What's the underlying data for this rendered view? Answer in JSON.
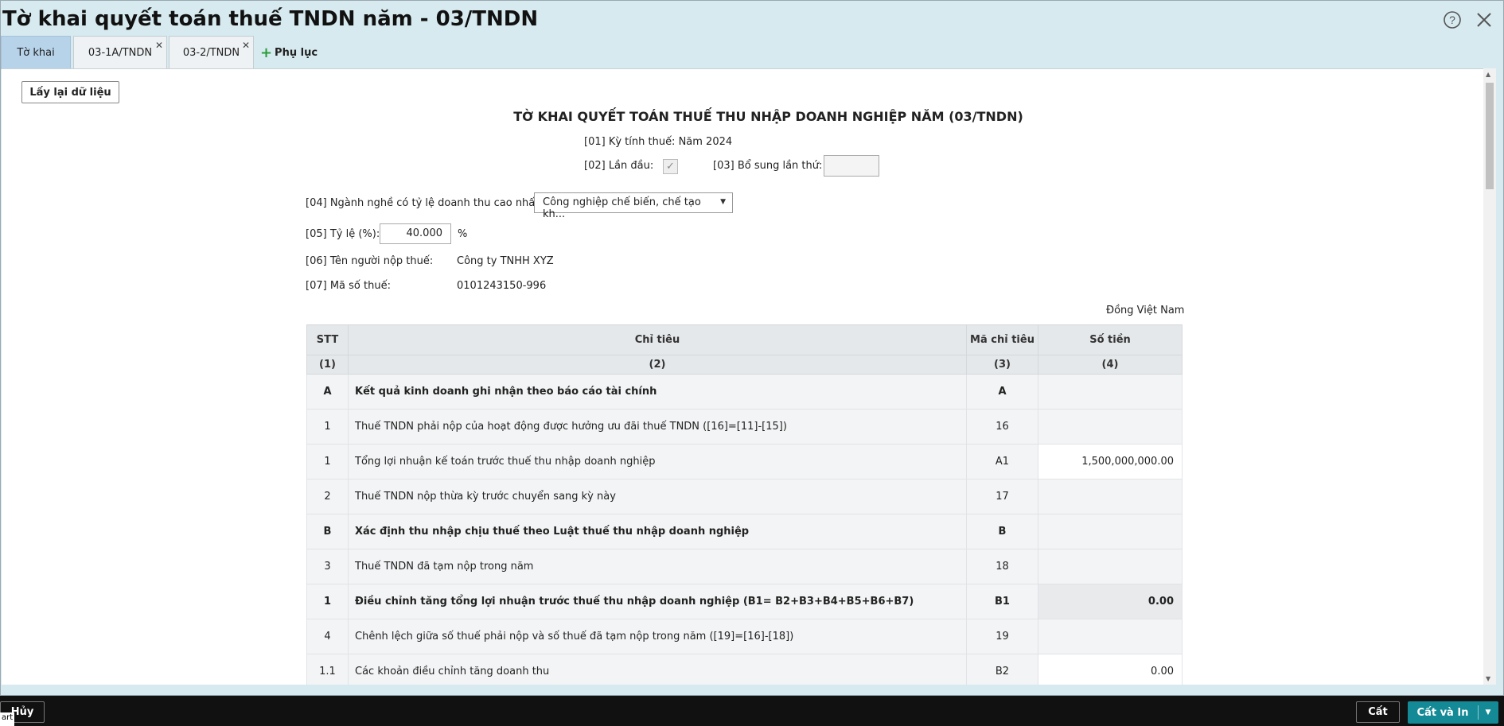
{
  "window": {
    "title": "Tờ khai quyết toán thuế TNDN năm - 03/TNDN",
    "help_icon": "help-circle-icon",
    "close_icon": "close-icon"
  },
  "tabs": [
    {
      "label": "Tờ khai",
      "active": true,
      "closable": false
    },
    {
      "label": "03-1A/TNDN",
      "active": false,
      "closable": true
    },
    {
      "label": "03-2/TNDN",
      "active": false,
      "closable": true
    }
  ],
  "add_tab_label": "Phụ lục",
  "reload_button": "Lấy lại dữ liệu",
  "form": {
    "title": "TỜ KHAI QUYẾT TOÁN THUẾ THU NHẬP DOANH NGHIỆP NĂM (03/TNDN)",
    "period": "[01] Kỳ tính thuế: Năm 2024",
    "first_time_label": "[02] Lần đầu:",
    "first_time_checked": true,
    "supplement_label": "[03] Bổ sung lần thứ:",
    "supplement_value": "",
    "industry_label": "[04] Ngành nghề có tỷ lệ doanh thu cao nhất:",
    "industry_value": "Công nghiệp chế biến, chế tạo kh...",
    "rate_label": "[05] Tỷ lệ (%):",
    "rate_value": "40.000",
    "rate_unit": "%",
    "taxpayer_label": "[06] Tên người nộp thuế:",
    "taxpayer_value": "Công ty TNHH XYZ",
    "tax_code_label": "[07] Mã số thuế:",
    "tax_code_value": "0101243150-996",
    "currency_note": "Đồng Việt Nam"
  },
  "table": {
    "headers": [
      "STT",
      "Chỉ tiêu",
      "Mã chỉ tiêu",
      "Số tiền"
    ],
    "subheaders": [
      "(1)",
      "(2)",
      "(3)",
      "(4)"
    ],
    "rows": [
      {
        "stt": "A",
        "name": "Kết quả kinh doanh ghi nhận theo báo cáo tài chính",
        "code": "A",
        "amount": "",
        "bold": true,
        "amount_style": "none"
      },
      {
        "stt": "1",
        "name": "Thuế TNDN phải nộp của hoạt động được hưởng ưu đãi thuế TNDN ([16]=[11]-[15])",
        "code": "16",
        "amount": "",
        "bold": false,
        "amount_style": "none"
      },
      {
        "stt": "1",
        "name": "Tổng lợi nhuận kế toán trước thuế thu nhập doanh nghiệp",
        "code": "A1",
        "amount": "1,500,000,000.00",
        "bold": false,
        "amount_style": "editable"
      },
      {
        "stt": "2",
        "name": "Thuế TNDN nộp thừa kỳ trước chuyển sang kỳ này",
        "code": "17",
        "amount": "",
        "bold": false,
        "amount_style": "none"
      },
      {
        "stt": "B",
        "name": "Xác định thu nhập chịu thuế theo Luật thuế thu nhập doanh nghiệp",
        "code": "B",
        "amount": "",
        "bold": true,
        "amount_style": "none"
      },
      {
        "stt": "3",
        "name": "Thuế TNDN đã tạm nộp trong năm",
        "code": "18",
        "amount": "",
        "bold": false,
        "amount_style": "none"
      },
      {
        "stt": "1",
        "name": "Điều chỉnh tăng tổng lợi nhuận trước thuế thu nhập doanh nghiệp (B1= B2+B3+B4+B5+B6+B7)",
        "code": "B1",
        "amount": "0.00",
        "bold": true,
        "amount_style": "computed"
      },
      {
        "stt": "4",
        "name": "Chênh lệch giữa số thuế phải nộp và số thuế đã tạm nộp trong năm ([19]=[16]-[18])",
        "code": "19",
        "amount": "",
        "bold": false,
        "amount_style": "none"
      },
      {
        "stt": "1.1",
        "name": "Các khoản điều chỉnh tăng doanh thu",
        "code": "B2",
        "amount": "0.00",
        "bold": false,
        "amount_style": "editable"
      }
    ]
  },
  "footer": {
    "cancel": "Hủy",
    "start_tag": "art",
    "save": "Cất",
    "save_print": "Cất và In"
  }
}
